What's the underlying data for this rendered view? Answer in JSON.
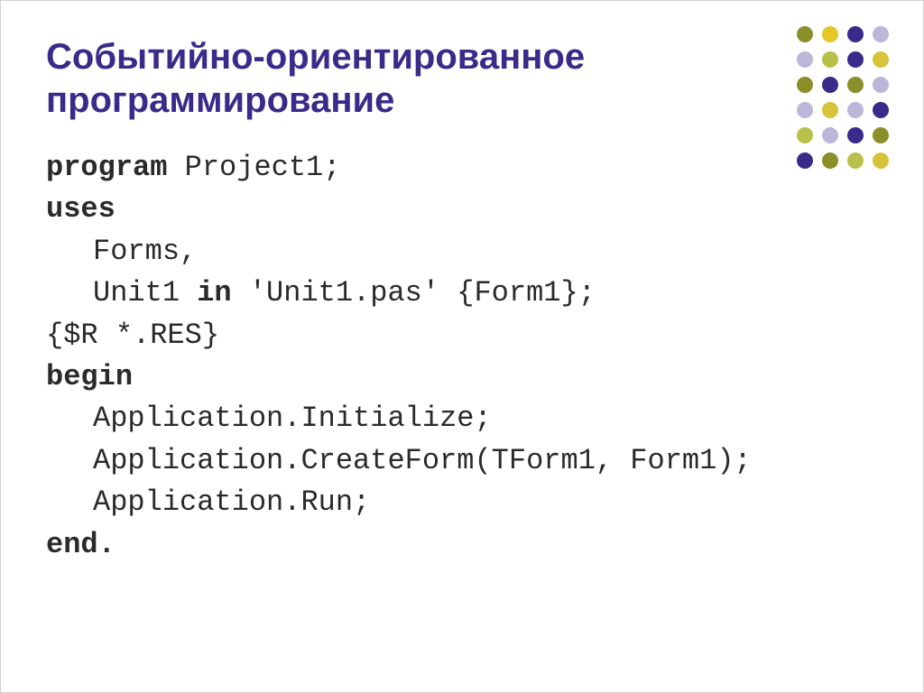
{
  "title": "Событийно-ориентированное программирование",
  "code": {
    "l1_kw": "program",
    "l1_rest": " Project1;",
    "l2": "uses",
    "l3": "Forms,",
    "l4a": "Unit1 ",
    "l4_kw": "in",
    "l4b": " 'Unit1.pas' {Form1};",
    "l5": "{$R *.RES}",
    "l6": "begin",
    "l7": "Application.Initialize;",
    "l8": "Application.CreateForm(TForm1, Form1);",
    "l9": "Application.Run;",
    "l10": "end."
  }
}
